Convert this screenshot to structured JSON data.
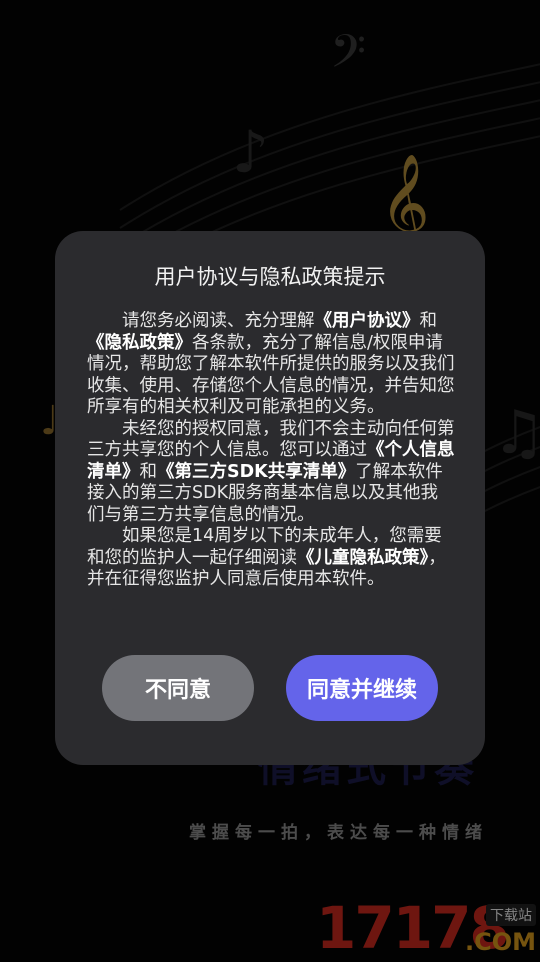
{
  "splash": {
    "slogan": "掌握每一拍，表达每一种情绪",
    "brand_title_partial": "情绪式节奏",
    "watermark": {
      "number": "17178",
      "download_label": "下载站",
      "domain": ".COM"
    }
  },
  "dialog": {
    "title": "用户协议与隐私政策提示",
    "paragraph1": {
      "t1": "请您务必阅读、充分理解",
      "link_user": "《用户协议》",
      "t2": "和",
      "link_privacy": "《隐私政策》",
      "t3": "各条款，充分了解信息/权限申请情况，帮助您了解本软件所提供的服务以及我们收集、使用、存储您个人信息的情况，并告知您所享有的相关权利及可能承担的义务。"
    },
    "paragraph2": {
      "t1": "未经您的授权同意，我们不会主动向任何第三方共享您的个人信息。您可以通过",
      "link_personal_info": "《个人信息清单》",
      "t2": "和",
      "link_sdk": "《第三方SDK共享清单》",
      "t3": "了解本软件接入的第三方SDK服务商基本信息以及其他我们与第三方共享信息的情况。"
    },
    "paragraph3": {
      "t1": "如果您是14周岁以下的未成年人，您需要和您的监护人一起仔细阅读",
      "link_child": "《儿童隐私政策》",
      "t2": "，并在征得您监护人同意后使用本软件。"
    },
    "buttons": {
      "disagree": "不同意",
      "agree": "同意并继续"
    }
  }
}
